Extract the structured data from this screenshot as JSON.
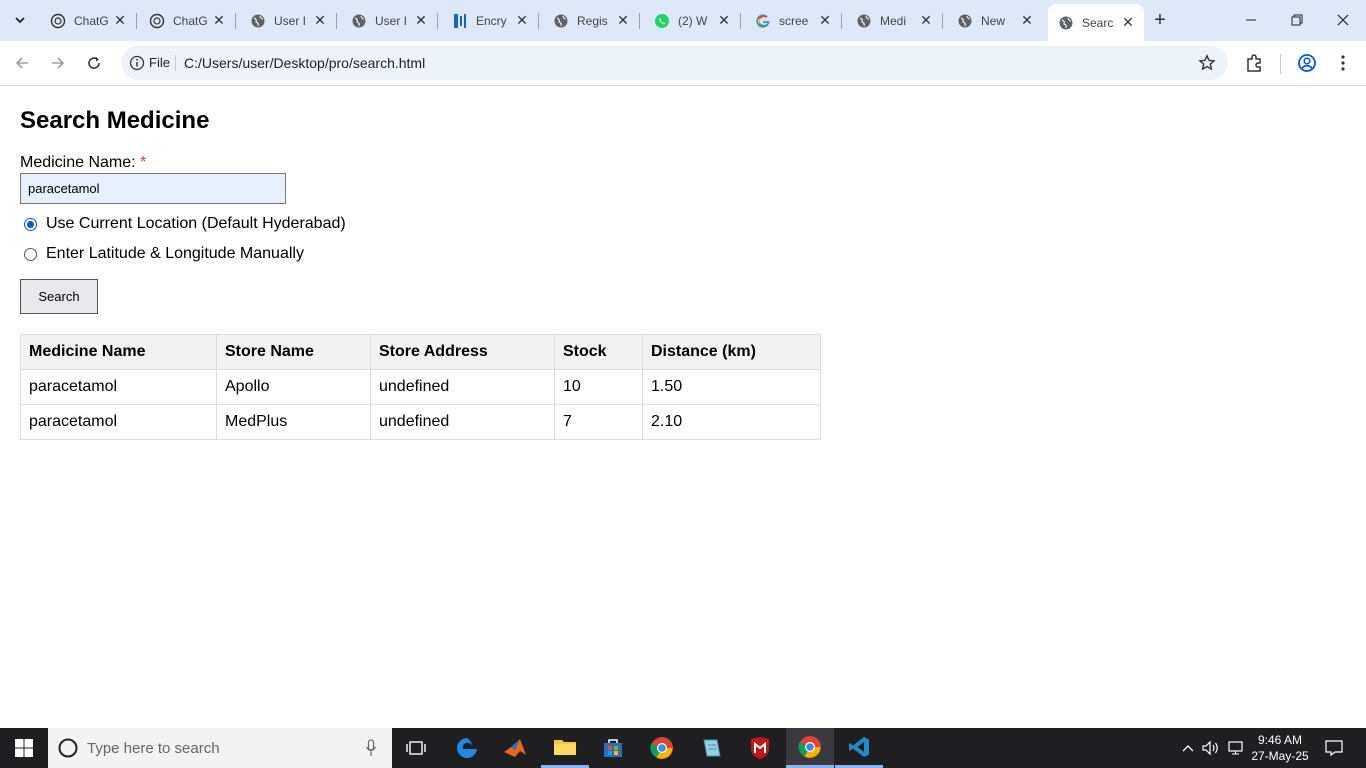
{
  "browser": {
    "tabs": [
      {
        "label": "ChatG",
        "icon": "chatgpt-icon"
      },
      {
        "label": "ChatG",
        "icon": "chatgpt-icon"
      },
      {
        "label": "User I",
        "icon": "globe-icon"
      },
      {
        "label": "User I",
        "icon": "globe-icon"
      },
      {
        "label": "Encry",
        "icon": "document-icon"
      },
      {
        "label": "Regis",
        "icon": "globe-icon"
      },
      {
        "label": "(2) W",
        "icon": "whatsapp-icon"
      },
      {
        "label": "scree",
        "icon": "google-icon"
      },
      {
        "label": "Medi",
        "icon": "globe-icon"
      },
      {
        "label": "New",
        "icon": "globe-icon"
      },
      {
        "label": "Searc",
        "icon": "globe-icon"
      }
    ],
    "active_tab_index": 10,
    "address": {
      "scheme_label": "File",
      "url": "C:/Users/user/Desktop/pro/search.html"
    },
    "accent_color": "#0b57d0"
  },
  "page": {
    "title": "Search Medicine",
    "medicine_label": "Medicine Name:",
    "required_mark": "*",
    "medicine_value": "paracetamol",
    "location_options": [
      {
        "label": "Use Current Location (Default Hyderabad)",
        "selected": true
      },
      {
        "label": "Enter Latitude & Longitude Manually",
        "selected": false
      }
    ],
    "search_button": "Search",
    "table": {
      "headers": [
        "Medicine Name",
        "Store Name",
        "Store Address",
        "Stock",
        "Distance (km)"
      ],
      "rows": [
        [
          "paracetamol",
          "Apollo",
          "undefined",
          "10",
          "1.50"
        ],
        [
          "paracetamol",
          "MedPlus",
          "undefined",
          "7",
          "2.10"
        ]
      ]
    }
  },
  "taskbar": {
    "search_placeholder": "Type here to search",
    "time": "9:46 AM",
    "date": "27-May-25"
  }
}
